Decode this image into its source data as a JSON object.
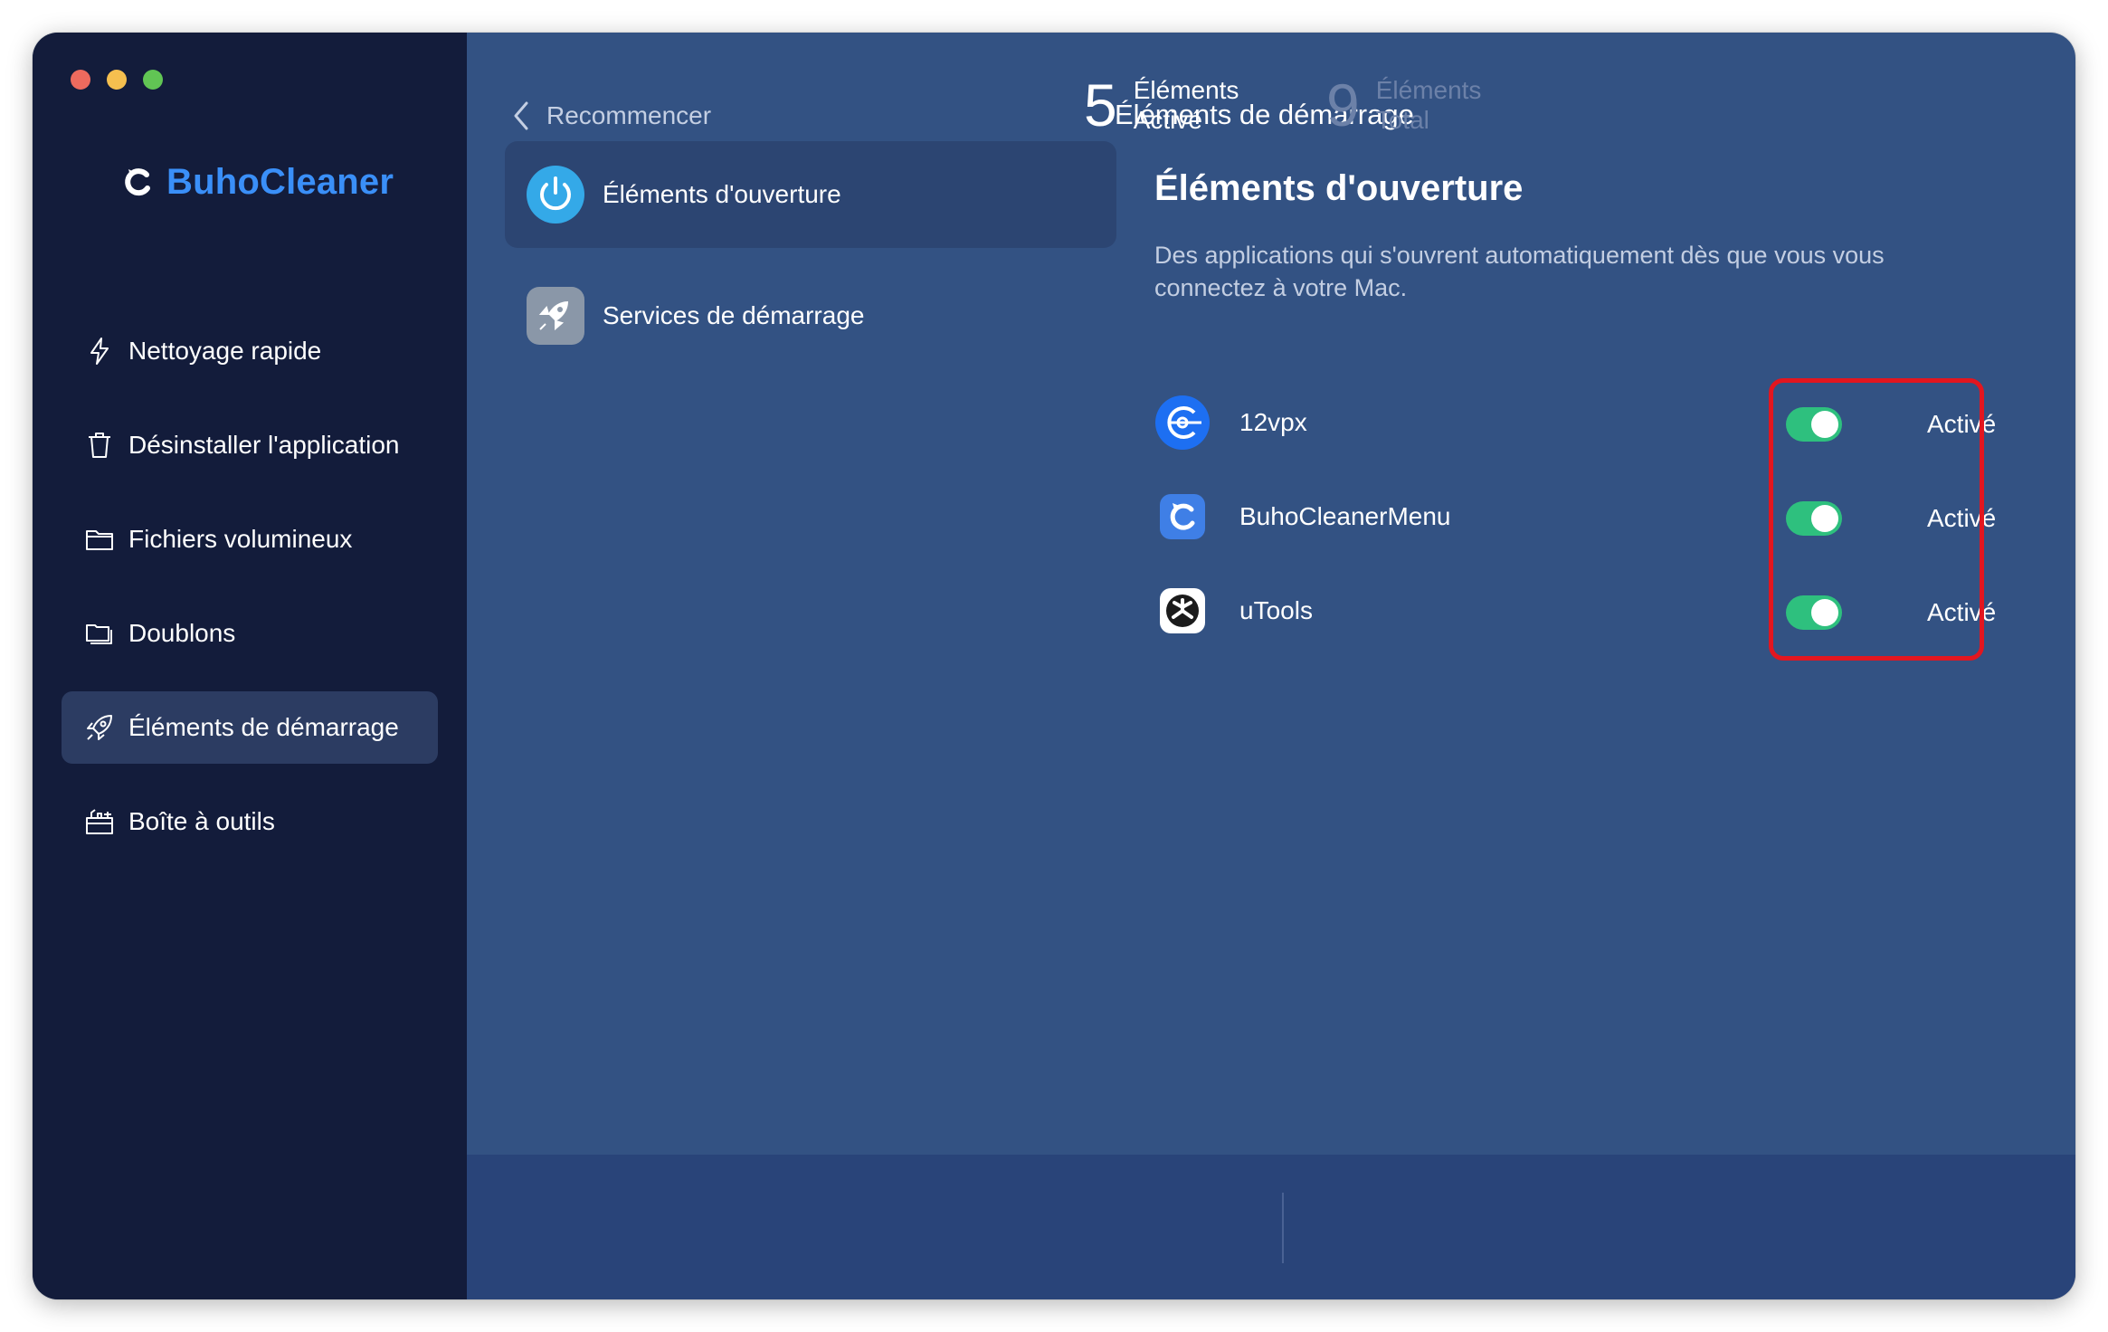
{
  "app": {
    "name": "BuhoCleaner",
    "brand_color": "#3a8ff8"
  },
  "sidebar": {
    "items": [
      {
        "label": "Nettoyage rapide",
        "icon": "bolt-icon"
      },
      {
        "label": "Désinstaller l'application",
        "icon": "trash-icon"
      },
      {
        "label": "Fichiers volumineux",
        "icon": "folder-icon"
      },
      {
        "label": "Doublons",
        "icon": "duplicate-folder-icon"
      },
      {
        "label": "Éléments de démarrage",
        "icon": "rocket-icon",
        "active": true
      },
      {
        "label": "Boîte à outils",
        "icon": "toolbox-icon"
      }
    ]
  },
  "header": {
    "back_label": "Recommencer",
    "title": "Éléments de démarrage"
  },
  "subnav": {
    "items": [
      {
        "label": "Éléments d'ouverture",
        "icon": "power-icon",
        "active": true
      },
      {
        "label": "Services de démarrage",
        "icon": "rocket-icon"
      }
    ]
  },
  "content": {
    "title": "Éléments d'ouverture",
    "description": "Des applications qui s'ouvrent automatiquement dès que vous vous connectez à votre Mac.",
    "apps": [
      {
        "name": "12vpx",
        "status": "Activé",
        "enabled": true,
        "icon": "12vpx-app-icon"
      },
      {
        "name": "BuhoCleanerMenu",
        "status": "Activé",
        "enabled": true,
        "icon": "buhocleaner-menu-app-icon"
      },
      {
        "name": "uTools",
        "status": "Activé",
        "enabled": true,
        "icon": "utools-app-icon"
      }
    ]
  },
  "footer": {
    "active_count": "5",
    "active_line1": "Éléments",
    "active_line2": "Activé",
    "total_count": "9",
    "total_line1": "Éléments",
    "total_line2": "Total"
  },
  "colors": {
    "sidebar_bg": "#131c3b",
    "main_bg": "#335283",
    "toggle_on": "#2ec07e",
    "highlight": "#e3161f"
  }
}
